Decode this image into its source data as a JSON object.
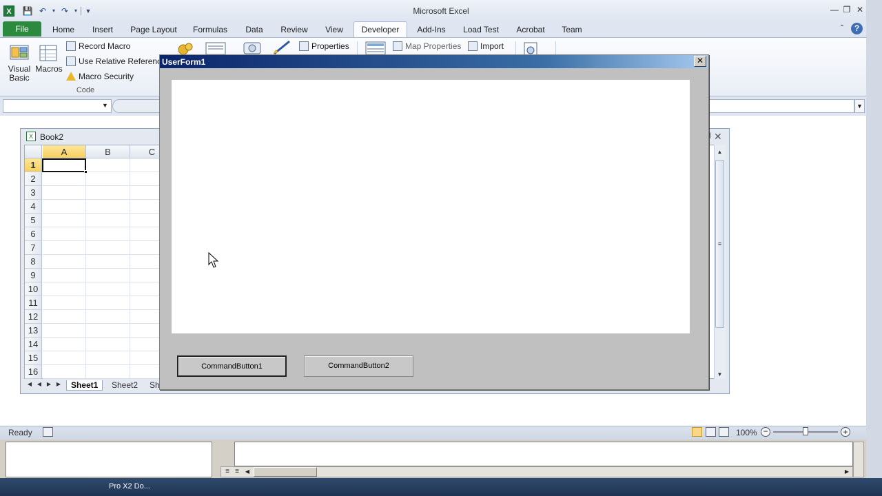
{
  "window": {
    "title": "Microsoft Excel",
    "app_icon": "X"
  },
  "ribbon_tabs": [
    "File",
    "Home",
    "Insert",
    "Page Layout",
    "Formulas",
    "Data",
    "Review",
    "View",
    "Developer",
    "Add-Ins",
    "Load Test",
    "Acrobat",
    "Team"
  ],
  "active_tab": "Developer",
  "ribbon": {
    "visual_basic": "Visual Basic",
    "visual_basic_line1": "Visual",
    "visual_basic_line2": "Basic",
    "macros": "Macros",
    "record_macro": "Record Macro",
    "use_relative": "Use Relative Reference",
    "macro_security": "Macro Security",
    "group_code": "Code",
    "properties": "Properties",
    "map_properties": "Map Properties",
    "import": "Import"
  },
  "workbook": {
    "title": "Book2",
    "columns": [
      "A",
      "B",
      "C"
    ],
    "rows": [
      "1",
      "2",
      "3",
      "4",
      "5",
      "6",
      "7",
      "8",
      "9",
      "10",
      "11",
      "12",
      "13",
      "14",
      "15",
      "16"
    ],
    "selected_cell": "A1",
    "sheets": [
      "Sheet1",
      "Sheet2",
      "Sh"
    ]
  },
  "userform": {
    "title": "UserForm1",
    "button1": "CommandButton1",
    "button2": "CommandButton2",
    "close_glyph": "✕"
  },
  "status": {
    "ready": "Ready",
    "zoom": "100%"
  },
  "taskbar": {
    "item": "Pro X2 Do..."
  },
  "colors": {
    "file_tab": "#2b8a3e",
    "selected_header": "#f7cf5f",
    "userform_title": "#0a246a"
  }
}
